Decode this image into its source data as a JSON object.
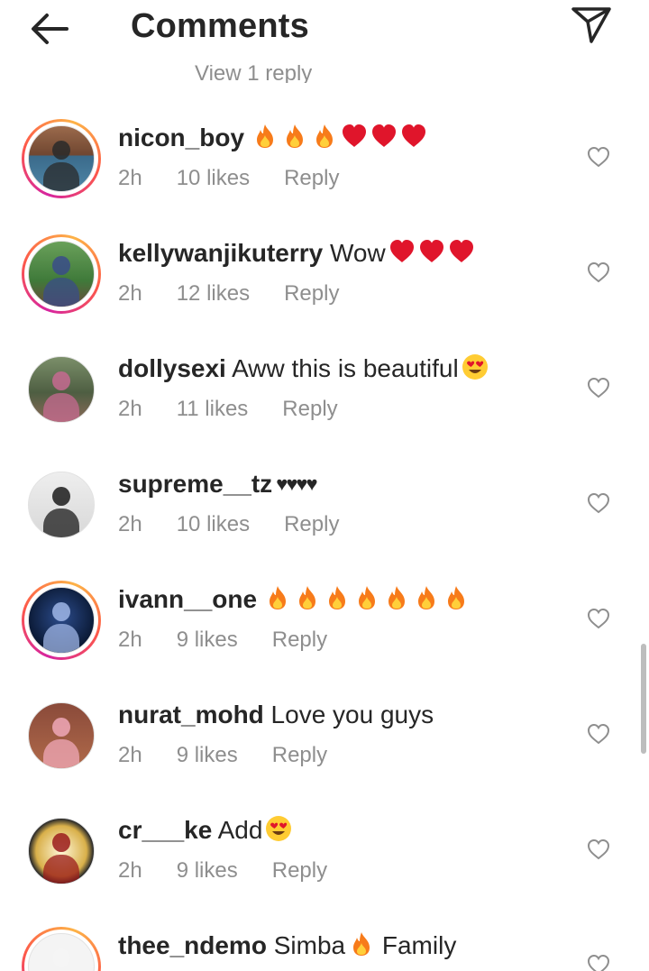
{
  "header": {
    "title": "Comments",
    "back_icon": "arrow-left-icon",
    "share_icon": "paper-plane-icon"
  },
  "view_reply_label": "View 1 reply",
  "comments": [
    {
      "username": "nicon_boy",
      "text": "",
      "emoji": [
        "fire",
        "fire",
        "fire",
        "red-heart",
        "red-heart",
        "red-heart"
      ],
      "time": "2h",
      "likes": "10 likes",
      "reply": "Reply"
    },
    {
      "username": "kellywanjikuterry",
      "text": "Wow",
      "emoji": [
        "red-heart",
        "red-heart",
        "red-heart"
      ],
      "time": "2h",
      "likes": "12 likes",
      "reply": "Reply"
    },
    {
      "username": "dollysexi",
      "text": "Aww this is beautiful",
      "emoji": [
        "heart-eyes"
      ],
      "time": "2h",
      "likes": "11 likes",
      "reply": "Reply"
    },
    {
      "username": "supreme__tz",
      "text": "♥♥♥♥",
      "emoji": [],
      "time": "2h",
      "likes": "10 likes",
      "reply": "Reply"
    },
    {
      "username": "ivann__one",
      "text": "",
      "emoji": [
        "fire",
        "fire",
        "fire",
        "fire",
        "fire",
        "fire",
        "fire"
      ],
      "time": "2h",
      "likes": "9 likes",
      "reply": "Reply"
    },
    {
      "username": "nurat_mohd",
      "text": "Love you guys",
      "emoji": [],
      "time": "2h",
      "likes": "9 likes",
      "reply": "Reply"
    },
    {
      "username": "cr___ke",
      "text": "Add",
      "emoji": [
        "heart-eyes"
      ],
      "time": "2h",
      "likes": "9 likes",
      "reply": "Reply"
    },
    {
      "username": "thee_ndemo",
      "text": "Simba",
      "emoji": [
        "fire"
      ],
      "text_after": "Family",
      "time": "",
      "likes": "",
      "reply": ""
    }
  ],
  "colors": {
    "text": "#262626",
    "secondary": "#8e8e8e",
    "fire": "#f77b1a",
    "heart_red": "#e0152b",
    "story_ring": "#d6249f"
  }
}
